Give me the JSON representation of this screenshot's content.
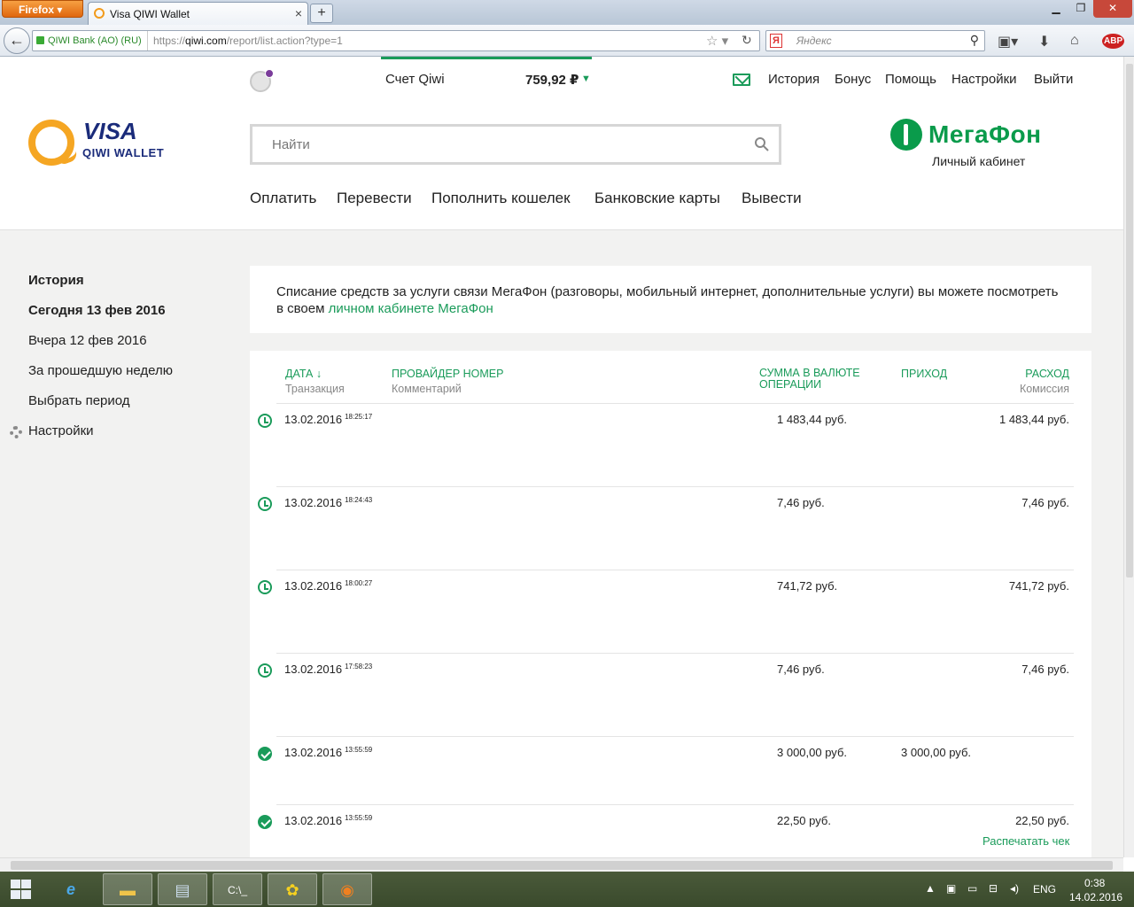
{
  "browser": {
    "app_button": "Firefox",
    "tab_title": "Visa QIWI Wallet",
    "site_identity": "QIWI Bank (AO) (RU)",
    "url_prefix": "https://",
    "url_domain": "qiwi.com",
    "url_path": "/report/list.action?type=1",
    "search_engine": "Яндекс",
    "search_engine_icon": "Я"
  },
  "header": {
    "account_label": "Счет Qiwi",
    "balance": "759,92 ₽",
    "top_nav": [
      "История",
      "Бонус",
      "Помощь",
      "Настройки",
      "Выйти"
    ],
    "logo_visa": "VISA",
    "logo_wallet": "QIWI WALLET",
    "search_placeholder": "Найти",
    "operator_name": "МегаФон",
    "operator_cabinet": "Личный кабинет",
    "main_nav": [
      "Оплатить",
      "Перевести",
      "Пополнить кошелек",
      "Банковские карты",
      "Вывести"
    ]
  },
  "sidebar": {
    "items": [
      {
        "label": "История",
        "bold": true
      },
      {
        "label": "Сегодня 13 фев 2016",
        "bold": true
      },
      {
        "label": "Вчера 12 фев 2016",
        "bold": false
      },
      {
        "label": "За прошедшую неделю",
        "bold": false
      },
      {
        "label": "Выбрать период",
        "bold": false
      },
      {
        "label": "Настройки",
        "bold": false
      }
    ]
  },
  "notice": {
    "text": "Списание средств за услуги связи МегаФон (разговоры, мобильный интернет, дополнительные услуги) вы можете посмотреть в своем ",
    "link": "личном кабинете МегаФон"
  },
  "table": {
    "headers": {
      "date": "ДАТА ↓",
      "date_sub": "Транзакция",
      "provider": "ПРОВАЙДЕР НОМЕР",
      "provider_sub": "Комментарий",
      "amount": "СУММА В ВАЛЮТЕ ОПЕРАЦИИ",
      "income": "ПРИХОД",
      "expense": "РАСХОД",
      "expense_sub": "Комиссия"
    },
    "rows": [
      {
        "status": "pending",
        "date": "13.02.2016",
        "time": "18:25:17",
        "amount": "1 483,44 руб.",
        "income": "",
        "expense": "1 483,44 руб."
      },
      {
        "status": "pending",
        "date": "13.02.2016",
        "time": "18:24:43",
        "amount": "7,46 руб.",
        "income": "",
        "expense": "7,46 руб."
      },
      {
        "status": "pending",
        "date": "13.02.2016",
        "time": "18:00:27",
        "amount": "741,72 руб.",
        "income": "",
        "expense": "741,72 руб."
      },
      {
        "status": "pending",
        "date": "13.02.2016",
        "time": "17:58:23",
        "amount": "7,46 руб.",
        "income": "",
        "expense": "7,46 руб."
      },
      {
        "status": "done",
        "date": "13.02.2016",
        "time": "13:55:59",
        "amount": "3 000,00 руб.",
        "income": "3 000,00 руб.",
        "expense": ""
      },
      {
        "status": "done",
        "date": "13.02.2016",
        "time": "13:55:59",
        "amount": "22,50 руб.",
        "income": "",
        "expense": "22,50 руб."
      }
    ],
    "print_receipt": "Распечатать чек"
  },
  "taskbar": {
    "language": "ENG",
    "time": "0:38",
    "date": "14.02.2016"
  }
}
